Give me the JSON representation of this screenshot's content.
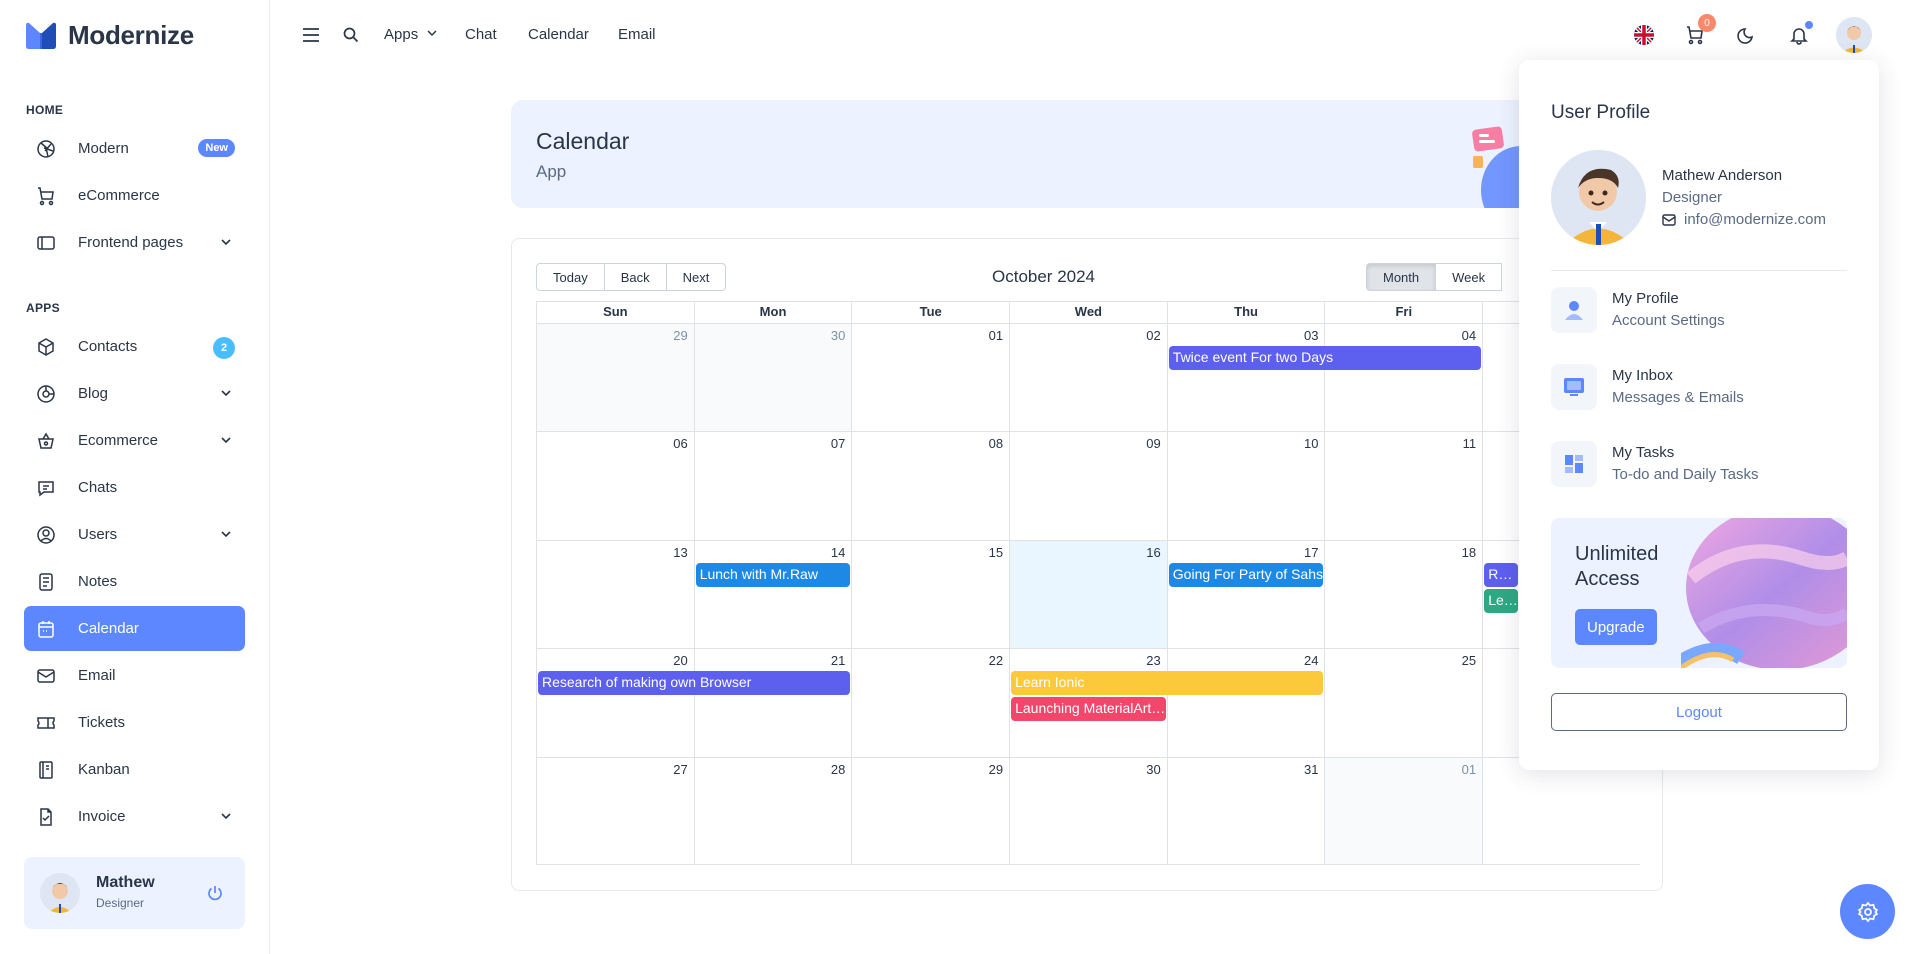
{
  "brand": {
    "name": "Modernize",
    "primary": "#5d87ff"
  },
  "sidebar": {
    "sections": {
      "home": "HOME",
      "apps": "APPS"
    },
    "items": [
      {
        "label": "Modern",
        "icon": "aperture-icon",
        "badge": "New"
      },
      {
        "label": "eCommerce",
        "icon": "shopping-cart-icon"
      },
      {
        "label": "Frontend pages",
        "icon": "layout-icon",
        "expandable": true
      },
      {
        "label": "Contacts",
        "icon": "package-icon",
        "badge": "2"
      },
      {
        "label": "Blog",
        "icon": "chart-donut-icon",
        "expandable": true
      },
      {
        "label": "Ecommerce",
        "icon": "basket-icon",
        "expandable": true
      },
      {
        "label": "Chats",
        "icon": "message-icon"
      },
      {
        "label": "Users",
        "icon": "user-circle-icon",
        "expandable": true
      },
      {
        "label": "Notes",
        "icon": "notes-icon"
      },
      {
        "label": "Calendar",
        "icon": "calendar-icon",
        "active": true
      },
      {
        "label": "Email",
        "icon": "mail-icon"
      },
      {
        "label": "Tickets",
        "icon": "ticket-icon"
      },
      {
        "label": "Kanban",
        "icon": "notebook-icon"
      },
      {
        "label": "Invoice",
        "icon": "file-check-icon",
        "expandable": true
      }
    ],
    "user": {
      "name": "Mathew",
      "role": "Designer"
    }
  },
  "topbar": {
    "links": [
      "Apps",
      "Chat",
      "Calendar",
      "Email"
    ],
    "cart_count": "0"
  },
  "banner": {
    "title": "Calendar",
    "subtitle": "App"
  },
  "calendar": {
    "nav": {
      "today": "Today",
      "back": "Back",
      "next": "Next"
    },
    "title": "October 2024",
    "views": {
      "month": "Month",
      "week": "Week"
    },
    "weekdays": [
      "Sun",
      "Mon",
      "Tue",
      "Wed",
      "Thu",
      "Fri"
    ],
    "weeks": [
      [
        "29",
        "30",
        "01",
        "02",
        "03",
        "04"
      ],
      [
        "06",
        "07",
        "08",
        "09",
        "10",
        "11"
      ],
      [
        "13",
        "14",
        "15",
        "16",
        "17",
        "18"
      ],
      [
        "20",
        "21",
        "22",
        "23",
        "24",
        "25"
      ],
      [
        "27",
        "28",
        "29",
        "30",
        "31",
        "01"
      ]
    ],
    "off_days": [
      [
        0,
        0
      ],
      [
        0,
        1
      ],
      [
        4,
        5
      ]
    ],
    "today": [
      2,
      3
    ],
    "events": [
      {
        "title": "Twice event For two Days",
        "week": 0,
        "start": 4,
        "span": 2,
        "row": 0,
        "color": "#5d5fef"
      },
      {
        "title": "Lunch with Mr.Raw",
        "week": 2,
        "start": 1,
        "span": 1,
        "row": 0,
        "color": "#1e88e5"
      },
      {
        "title": "Going For Party of Sahs",
        "week": 2,
        "start": 4,
        "span": 1,
        "row": 0,
        "color": "#1e88e5"
      },
      {
        "title": "Research of making own Browser",
        "week": 2,
        "start": 6,
        "span": 1,
        "row": 0,
        "color": "#5d5fef"
      },
      {
        "title": "Learn ReactJs",
        "week": 2,
        "start": 6,
        "span": 1,
        "row": 1,
        "color": "#2ea883"
      },
      {
        "title": "Research of making own Browser",
        "week": 3,
        "start": 0,
        "span": 2,
        "row": 0,
        "color": "#5d5fef"
      },
      {
        "title": "Learn Ionic",
        "week": 3,
        "start": 3,
        "span": 2,
        "row": 0,
        "color": "#fcc93a"
      },
      {
        "title": "Launching MaterialArt Angular",
        "week": 3,
        "start": 3,
        "span": 1,
        "row": 1,
        "color": "#f3466b"
      }
    ]
  },
  "profile_menu": {
    "title": "User Profile",
    "name": "Mathew Anderson",
    "role": "Designer",
    "email": "info@modernize.com",
    "links": [
      {
        "title": "My Profile",
        "subtitle": "Account Settings"
      },
      {
        "title": "My Inbox",
        "subtitle": "Messages & Emails"
      },
      {
        "title": "My Tasks",
        "subtitle": "To-do and Daily Tasks"
      }
    ],
    "promo": {
      "title": "Unlimited Access",
      "button": "Upgrade"
    },
    "logout": "Logout"
  }
}
